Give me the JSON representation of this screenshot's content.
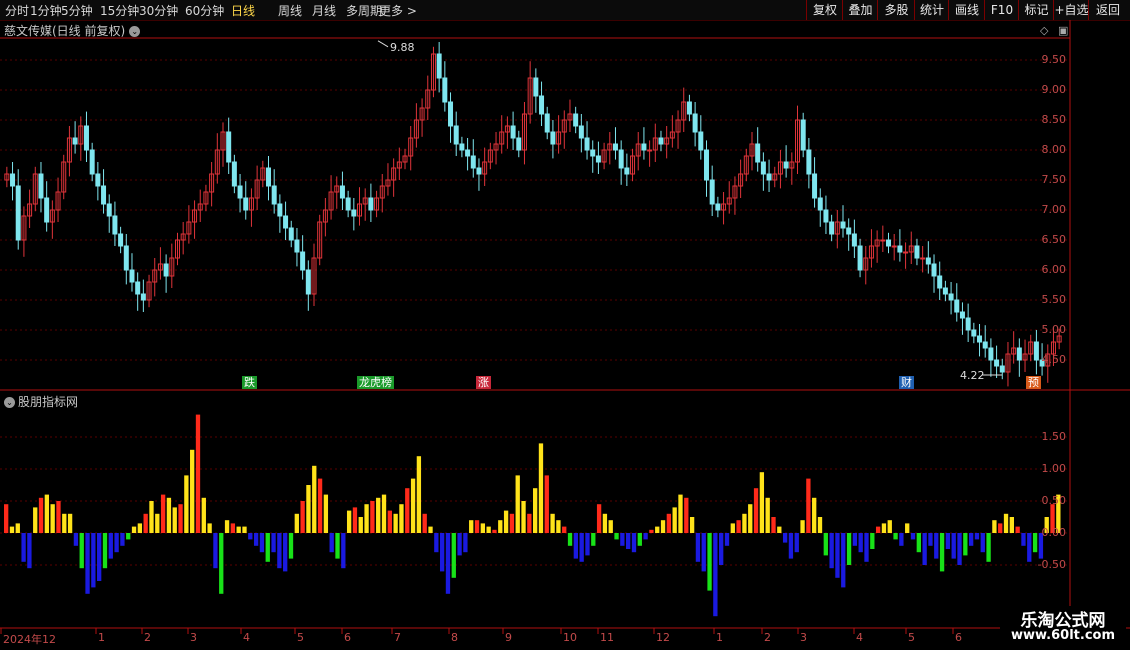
{
  "toolbar": {
    "periods": [
      "分时",
      "1分钟",
      "5分钟",
      "15分钟",
      "30分钟",
      "60分钟",
      "日线",
      "周线",
      "月线",
      "多周期",
      "更多 >"
    ],
    "active_period": "日线",
    "actions": [
      "复权",
      "叠加",
      "多股",
      "统计",
      "画线",
      "F10",
      "标记",
      "+自选",
      "返回"
    ]
  },
  "main_pane": {
    "title": "慈文传媒(日线 前复权)",
    "high_marker": "9.88",
    "low_marker": "4.22",
    "y_ticks": [
      "9.50",
      "9.00",
      "8.50",
      "8.00",
      "7.50",
      "7.00",
      "6.50",
      "6.00",
      "5.50",
      "5.00",
      "4.50"
    ],
    "tags": [
      {
        "text": "跌",
        "color": "#1a9a2a"
      },
      {
        "text": "龙虎榜",
        "color": "#1a9a2a"
      },
      {
        "text": "涨",
        "color": "#c8283a"
      },
      {
        "text": "财",
        "color": "#1f5fb0"
      },
      {
        "text": "预",
        "color": "#d85a1a"
      }
    ]
  },
  "indicator_pane": {
    "title": "股朋指标网",
    "y_ticks": [
      "1.50",
      "1.00",
      "0.50",
      "0.00",
      "-0.50"
    ]
  },
  "x_axis": {
    "labels": [
      "2024年12",
      "1",
      "2",
      "3",
      "4",
      "5",
      "6",
      "7",
      "8",
      "9",
      "10",
      "11",
      "12",
      "1",
      "2",
      "3",
      "4",
      "5",
      "6"
    ]
  },
  "watermark": {
    "line1": "乐淘公式网",
    "line2": "www.60lt.com"
  },
  "colors": {
    "up": "#e0343a",
    "down": "#7fe6ef",
    "grid": "#5a0000",
    "axis": "#b01010",
    "yellow": "#ffe31a",
    "red": "#ff2a1a",
    "green": "#18e218",
    "blue": "#1a1ae0"
  },
  "chart_data": {
    "type": "candlestick",
    "series": [
      {
        "name": "price_close",
        "values": [
          7.6,
          7.4,
          6.5,
          6.9,
          7.1,
          7.6,
          7.2,
          6.8,
          7.0,
          7.3,
          7.8,
          8.2,
          8.1,
          8.4,
          8.0,
          7.6,
          7.4,
          7.1,
          6.9,
          6.6,
          6.4,
          6.0,
          5.8,
          5.6,
          5.5,
          5.8,
          6.0,
          6.1,
          5.9,
          6.2,
          6.5,
          6.6,
          6.8,
          7.0,
          7.1,
          7.3,
          7.6,
          8.0,
          8.3,
          7.8,
          7.4,
          7.2,
          7.0,
          7.2,
          7.5,
          7.7,
          7.4,
          7.1,
          6.9,
          6.7,
          6.5,
          6.3,
          6.0,
          5.6,
          6.2,
          6.8,
          7.0,
          7.3,
          7.4,
          7.2,
          7.0,
          6.9,
          7.1,
          7.2,
          7.0,
          7.2,
          7.4,
          7.5,
          7.7,
          7.8,
          7.9,
          8.2,
          8.5,
          8.7,
          9.0,
          9.6,
          9.2,
          8.8,
          8.4,
          8.1,
          8.0,
          7.9,
          7.7,
          7.6,
          7.8,
          8.0,
          8.1,
          8.3,
          8.4,
          8.2,
          8.0,
          8.6,
          9.2,
          8.9,
          8.6,
          8.3,
          8.1,
          8.3,
          8.5,
          8.6,
          8.4,
          8.2,
          8.0,
          7.9,
          7.8,
          8.0,
          8.1,
          8.0,
          7.7,
          7.6,
          7.9,
          8.1,
          8.0,
          8.0,
          8.2,
          8.1,
          8.2,
          8.3,
          8.5,
          8.8,
          8.6,
          8.3,
          8.0,
          7.5,
          7.1,
          7.0,
          7.1,
          7.2,
          7.4,
          7.6,
          7.9,
          8.1,
          7.8,
          7.6,
          7.5,
          7.6,
          7.8,
          7.7,
          7.8,
          8.5,
          8.0,
          7.6,
          7.2,
          7.0,
          6.8,
          6.6,
          6.8,
          6.7,
          6.6,
          6.4,
          6.0,
          6.2,
          6.4,
          6.5,
          6.5,
          6.4,
          6.4,
          6.3,
          6.3,
          6.4,
          6.2,
          6.2,
          6.1,
          5.9,
          5.7,
          5.6,
          5.5,
          5.3,
          5.2,
          5.0,
          4.9,
          4.8,
          4.7,
          4.5,
          4.4,
          4.3,
          4.6,
          4.7,
          4.5,
          4.6,
          4.8,
          4.5,
          4.4,
          4.6,
          4.8,
          4.9
        ]
      },
      {
        "name": "indicator",
        "values": [
          0.45,
          0.1,
          0.15,
          -0.45,
          -0.55,
          0.4,
          0.55,
          0.6,
          0.45,
          0.5,
          0.3,
          0.3,
          -0.2,
          -0.55,
          -0.95,
          -0.85,
          -0.75,
          -0.55,
          -0.4,
          -0.3,
          -0.2,
          -0.1,
          0.1,
          0.15,
          0.3,
          0.5,
          0.3,
          0.6,
          0.55,
          0.4,
          0.45,
          0.9,
          1.3,
          1.85,
          0.55,
          0.15,
          -0.55,
          -0.95,
          0.2,
          0.15,
          0.1,
          0.1,
          -0.1,
          -0.2,
          -0.3,
          -0.45,
          -0.3,
          -0.55,
          -0.6,
          -0.4,
          0.3,
          0.5,
          0.75,
          1.05,
          0.85,
          0.6,
          -0.3,
          -0.4,
          -0.55,
          0.35,
          0.4,
          0.25,
          0.45,
          0.5,
          0.55,
          0.6,
          0.35,
          0.3,
          0.45,
          0.7,
          0.85,
          1.2,
          0.3,
          0.1,
          -0.3,
          -0.6,
          -0.95,
          -0.7,
          -0.35,
          -0.3,
          0.2,
          0.2,
          0.15,
          0.1,
          0.05,
          0.2,
          0.35,
          0.3,
          0.9,
          0.5,
          0.3,
          0.7,
          1.4,
          0.9,
          0.3,
          0.2,
          0.1,
          -0.2,
          -0.4,
          -0.45,
          -0.35,
          -0.2,
          0.45,
          0.3,
          0.2,
          -0.1,
          -0.2,
          -0.25,
          -0.3,
          -0.2,
          -0.1,
          0.05,
          0.1,
          0.2,
          0.3,
          0.4,
          0.6,
          0.55,
          0.25,
          -0.45,
          -0.6,
          -0.9,
          -1.3,
          -0.5,
          -0.2,
          0.15,
          0.2,
          0.3,
          0.45,
          0.7,
          0.95,
          0.55,
          0.25,
          0.1,
          -0.15,
          -0.4,
          -0.3,
          0.2,
          0.85,
          0.55,
          0.25,
          -0.35,
          -0.55,
          -0.7,
          -0.85,
          -0.5,
          -0.2,
          -0.3,
          -0.45,
          -0.25,
          0.1,
          0.15,
          0.2,
          -0.1,
          -0.2,
          0.15,
          -0.1,
          -0.3,
          -0.5,
          -0.2,
          -0.4,
          -0.6,
          -0.25,
          -0.4,
          -0.5,
          -0.35,
          -0.2,
          -0.1,
          -0.3,
          -0.45,
          0.2,
          0.15,
          0.3,
          0.25,
          0.1,
          -0.2,
          -0.45,
          -0.3,
          -0.4,
          0.25,
          0.45,
          0.6
        ]
      }
    ]
  }
}
